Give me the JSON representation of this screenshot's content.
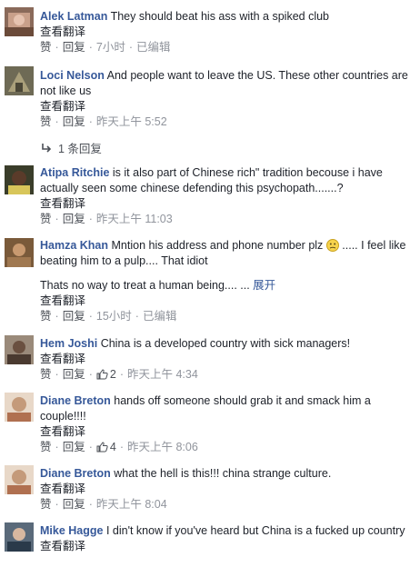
{
  "comments": [
    {
      "name": "Alek Latman",
      "text": "They should beat his ass with a spiked club",
      "translate": "查看翻译",
      "like": "赞",
      "reply": "回复",
      "time": "7小时",
      "edited": "已编辑"
    },
    {
      "name": "Loci Nelson",
      "text": "And people want to leave the US. These other countries are not like us",
      "translate": "查看翻译",
      "like": "赞",
      "reply": "回复",
      "time": "昨天上午 5:52",
      "replies": "1 条回复"
    },
    {
      "name": "Atipa Ritchie",
      "text": "is it also part of Chinese rich\" tradition becouse i have actually seen some chinese defending this psychopath.......?",
      "translate": "查看翻译",
      "like": "赞",
      "reply": "回复",
      "time": "昨天上午 11:03"
    },
    {
      "name": "Hamza Khan",
      "text": "Mntion his address and phone number plz",
      "text2": "..... I feel like beating him to a pulp.... That idiot",
      "text3": "Thats no way to treat a human being.... ...",
      "expand": "展开",
      "translate": "查看翻译",
      "like": "赞",
      "reply": "回复",
      "time": "15小时",
      "edited": "已编辑"
    },
    {
      "name": "Hem Joshi",
      "text": "China is a developed country with sick managers!",
      "translate": "查看翻译",
      "like": "赞",
      "reply": "回复",
      "likes": "2",
      "time": "昨天上午 4:34"
    },
    {
      "name": "Diane Breton",
      "text": "hands off someone should grab it and smack him a couple!!!!",
      "translate": "查看翻译",
      "like": "赞",
      "reply": "回复",
      "likes": "4",
      "time": "昨天上午 8:06"
    },
    {
      "name": "Diane Breton",
      "text": "what the hell is this!!! china strange culture.",
      "translate": "查看翻译",
      "like": "赞",
      "reply": "回复",
      "time": "昨天上午 8:04"
    },
    {
      "name": "Mike Hagge",
      "text": "I din't know if you've heard but China is a fucked up country",
      "translate": "查看翻译"
    }
  ],
  "colors": {
    "name": "#365899",
    "meta": "#90949c",
    "text": "#1d2129"
  },
  "icons": {
    "reply_arrow": "reply-arrow-icon",
    "like": "thumbs-up-icon",
    "emoji": "confused-face-icon"
  }
}
